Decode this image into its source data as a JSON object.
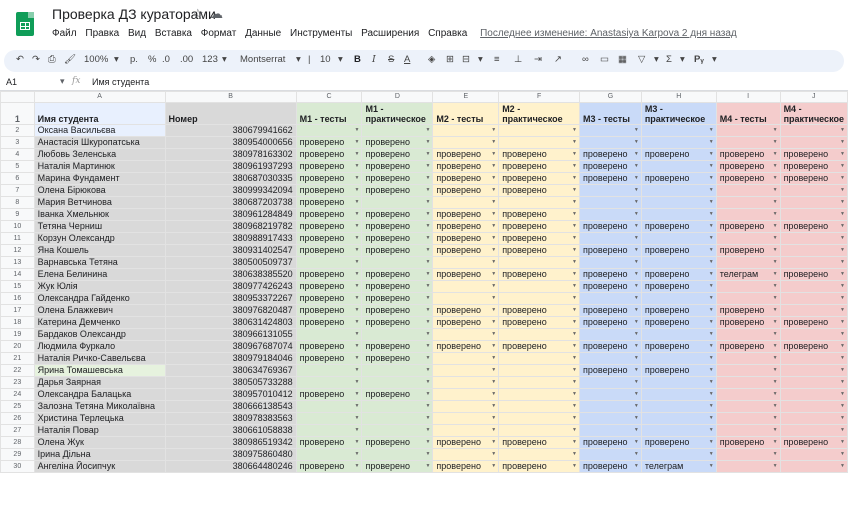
{
  "doc": {
    "title": "Проверка ДЗ кураторами",
    "menu": [
      "Файл",
      "Правка",
      "Вид",
      "Вставка",
      "Формат",
      "Данные",
      "Инструменты",
      "Расширения",
      "Справка"
    ],
    "last_edit": "Последнее изменение: Anastasiya Karpova 2 дня назад"
  },
  "toolbar": {
    "zoom": "100%",
    "currency": "р.",
    "percent": "%",
    "dec_less": ".0",
    "dec_more": ".00",
    "format": "123",
    "font": "Montserrat",
    "size": "10",
    "bold": "B",
    "italic": "I",
    "strike": "S",
    "text_color": "A"
  },
  "formula": {
    "cell": "A1",
    "fx": "fx",
    "value": "Имя студента"
  },
  "columns": [
    "A",
    "B",
    "C",
    "D",
    "E",
    "F",
    "G",
    "H",
    "I",
    "J"
  ],
  "headers": [
    "Имя студента",
    "Номер",
    "М1 - тесты",
    "М1 - практическое",
    "М2 - тесты",
    "М2 - практическое",
    "М3 - тесты",
    "М3 - практическое",
    "М4 - тесты",
    "М4 - практическое"
  ],
  "rows": [
    [
      "Оксана Васильєва",
      "380679941662",
      "",
      "",
      "",
      "",
      "",
      "",
      "",
      ""
    ],
    [
      "Анастасія Шкуропатська",
      "380954000656",
      "проверено",
      "проверено",
      "",
      "",
      "",
      "",
      "",
      ""
    ],
    [
      "Любовь Зеленська",
      "380978163302",
      "проверено",
      "проверено",
      "проверено",
      "проверено",
      "проверено",
      "проверено",
      "проверено",
      "проверено"
    ],
    [
      "Наталія Мартинюк",
      "380961937293",
      "проверено",
      "проверено",
      "проверено",
      "проверено",
      "проверено",
      "",
      "проверено",
      "проверено"
    ],
    [
      "Марина Фундамент",
      "380687030335",
      "проверено",
      "проверено",
      "проверено",
      "проверено",
      "проверено",
      "проверено",
      "проверено",
      "проверено"
    ],
    [
      "Олена Бірюкова",
      "380999342094",
      "проверено",
      "проверено",
      "проверено",
      "проверено",
      "",
      "",
      "",
      ""
    ],
    [
      "Мария Ветчинова",
      "380687203738",
      "проверено",
      "",
      "",
      "",
      "",
      "",
      "",
      ""
    ],
    [
      "Іванка Хмельнюк",
      "380961284849",
      "проверено",
      "проверено",
      "проверено",
      "проверено",
      "",
      "",
      "",
      ""
    ],
    [
      "Тетяна Черниш",
      "380968219782",
      "проверено",
      "проверено",
      "проверено",
      "проверено",
      "проверено",
      "проверено",
      "проверено",
      "проверено"
    ],
    [
      "Корзун Олександр",
      "380988917433",
      "проверено",
      "проверено",
      "проверено",
      "проверено",
      "",
      "",
      "",
      ""
    ],
    [
      "Яна Кошель",
      "380931402547",
      "проверено",
      "проверено",
      "проверено",
      "проверено",
      "проверено",
      "проверено",
      "проверено",
      ""
    ],
    [
      "Варнавська Тетяна",
      "380500509737",
      "",
      "",
      "",
      "",
      "",
      "",
      "",
      ""
    ],
    [
      "Елена Белинина",
      "380638385520",
      "проверено",
      "проверено",
      "проверено",
      "проверено",
      "проверено",
      "проверено",
      "телеграм",
      "проверено"
    ],
    [
      "Жук Юлія",
      "380977426243",
      "проверено",
      "проверено",
      "",
      "",
      "проверено",
      "проверено",
      "",
      ""
    ],
    [
      "Олександра Гайденко",
      "380953372267",
      "проверено",
      "проверено",
      "",
      "",
      "",
      "",
      "",
      ""
    ],
    [
      "Олена Блажкевич",
      "380976820487",
      "проверено",
      "проверено",
      "проверено",
      "проверено",
      "проверено",
      "проверено",
      "проверено",
      ""
    ],
    [
      "Катерина Демченко",
      "380631424803",
      "проверено",
      "проверено",
      "проверено",
      "проверено",
      "проверено",
      "проверено",
      "проверено",
      "проверено"
    ],
    [
      "Бардаков Олександр",
      "380966131055",
      "",
      "",
      "",
      "",
      "",
      "",
      "",
      ""
    ],
    [
      "Людмила Фуркало",
      "380967687074",
      "проверено",
      "проверено",
      "проверено",
      "проверено",
      "проверено",
      "проверено",
      "проверено",
      "проверено"
    ],
    [
      "Наталія Ричко-Савельєва",
      "380979184046",
      "проверено",
      "проверено",
      "",
      "",
      "",
      "",
      "",
      ""
    ],
    [
      "Ярина Томашевська",
      "380634769367",
      "",
      "",
      "",
      "",
      "проверено",
      "проверено",
      "",
      ""
    ],
    [
      "Дарья Заярная",
      "380505733288",
      "",
      "",
      "",
      "",
      "",
      "",
      "",
      ""
    ],
    [
      "Олександра Балацька",
      "380957010412",
      "проверено",
      "проверено",
      "",
      "",
      "",
      "",
      "",
      ""
    ],
    [
      "Залозна Тетяна Миколаївна",
      "380666138543",
      "",
      "",
      "",
      "",
      "",
      "",
      "",
      ""
    ],
    [
      "Христина Терлецька",
      "380978383563",
      "",
      "",
      "",
      "",
      "",
      "",
      "",
      ""
    ],
    [
      "Наталія Повар",
      "380661058838",
      "",
      "",
      "",
      "",
      "",
      "",
      "",
      ""
    ],
    [
      "Олена Жук",
      "380986519342",
      "проверено",
      "проверено",
      "проверено",
      "проверено",
      "проверено",
      "проверено",
      "проверено",
      "проверено"
    ],
    [
      "Ірина Дільна",
      "380975860480",
      "",
      "",
      "",
      "",
      "",
      "",
      "",
      ""
    ],
    [
      "Ангеліна Йосипчук",
      "380664480246",
      "проверено",
      "проверено",
      "проверено",
      "проверено",
      "проверено",
      "телеграм",
      "",
      ""
    ]
  ]
}
